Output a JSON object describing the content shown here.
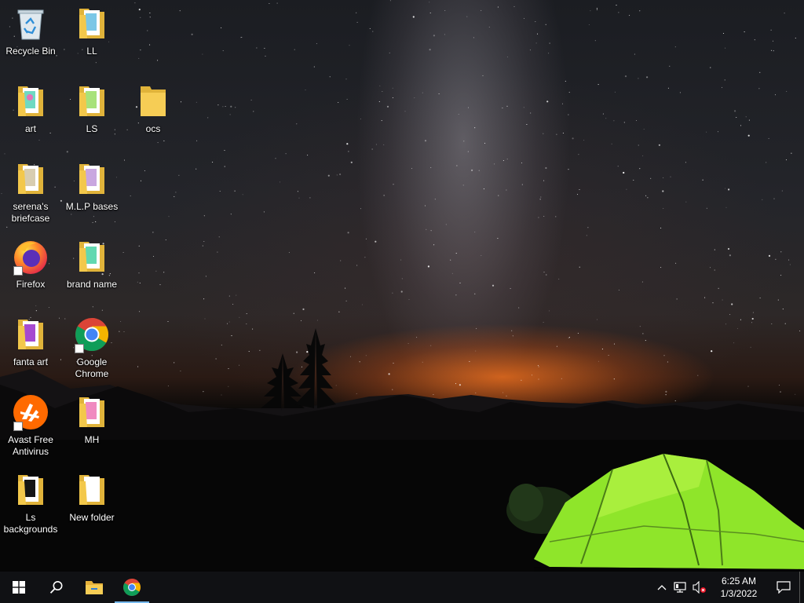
{
  "desktop": {
    "icons": [
      {
        "label": "Recycle Bin",
        "type": "recycle-bin"
      },
      {
        "label": "LL",
        "type": "folder"
      },
      {
        "label": "art",
        "type": "folder"
      },
      {
        "label": "LS",
        "type": "folder"
      },
      {
        "label": "ocs",
        "type": "folder"
      },
      {
        "label": "serena's briefcase",
        "type": "folder"
      },
      {
        "label": "M.L.P bases",
        "type": "folder"
      },
      {
        "label": "Firefox",
        "type": "firefox-shortcut"
      },
      {
        "label": "brand name",
        "type": "folder"
      },
      {
        "label": "fanta art",
        "type": "folder"
      },
      {
        "label": "Google Chrome",
        "type": "chrome-shortcut"
      },
      {
        "label": "Avast Free Antivirus",
        "type": "avast-shortcut"
      },
      {
        "label": "MH",
        "type": "folder"
      },
      {
        "label": "Ls backgrounds",
        "type": "folder"
      },
      {
        "label": "New folder",
        "type": "folder"
      }
    ]
  },
  "taskbar": {
    "pinned": [
      "start-icon",
      "search-icon",
      "file-explorer-icon",
      "chrome-icon"
    ],
    "tray": {
      "time": "6:25 AM",
      "date": "1/3/2022"
    }
  },
  "colors": {
    "taskbar_bg": "#101114",
    "active_indicator": "#76b9ed",
    "folder_yellow": "#f3c84b",
    "tent_green": "#8fe52a"
  }
}
